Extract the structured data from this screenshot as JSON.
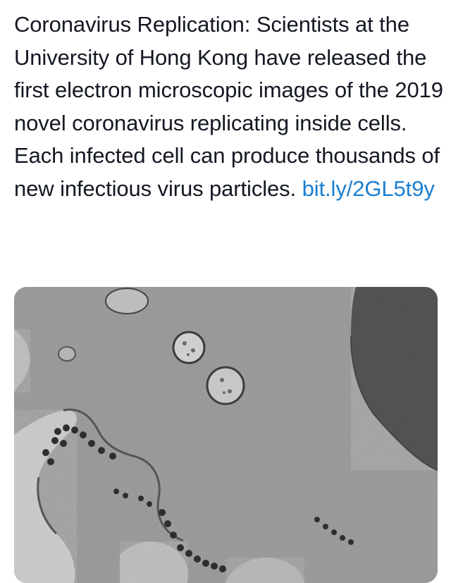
{
  "tweet": {
    "text": "Coronavirus Replication: Scientists at the University of Hong Kong have released the first electron microscopic images of the 2019 novel coronavirus replicating inside cells. Each infected cell can produce thousands of new infectious virus particles.",
    "link_text": "bit.ly/2GL5t9y"
  },
  "media": {
    "kind": "electron-micrograph",
    "colors": {
      "background": "#9a9a9a",
      "lumen": "#d8d8d8",
      "dense": "#3a3a3a"
    }
  }
}
